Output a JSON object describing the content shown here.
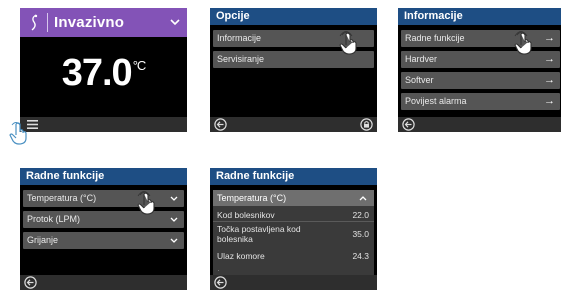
{
  "screen1": {
    "mode_label": "Invazivno",
    "temperature": "37.0",
    "unit": "°C"
  },
  "screen2": {
    "title": "Opcije",
    "items": [
      "Informacije",
      "Servisiranje"
    ]
  },
  "screen3": {
    "title": "Informacije",
    "items": [
      "Radne funkcije",
      "Hardver",
      "Softver",
      "Povijest alarma"
    ],
    "arrow": "→"
  },
  "screen4": {
    "title": "Radne funkcije",
    "items": [
      "Temperatura (°C)",
      "Protok (LPM)",
      "Grijanje"
    ]
  },
  "screen5": {
    "title": "Radne funkcije",
    "open_section": "Temperatura (°C)",
    "rows": [
      {
        "label": "Kod bolesnikov",
        "value": "22.0"
      },
      {
        "label": "Točka postavljena kod bolesnika",
        "value": "35.0"
      },
      {
        "label": "Ulaz komore",
        "value": "24.3"
      }
    ]
  },
  "colors": {
    "title_bar": "#1e4e84",
    "mode_header": "#8353b7",
    "row_bg": "#555555",
    "screen_bg": "#000000"
  }
}
